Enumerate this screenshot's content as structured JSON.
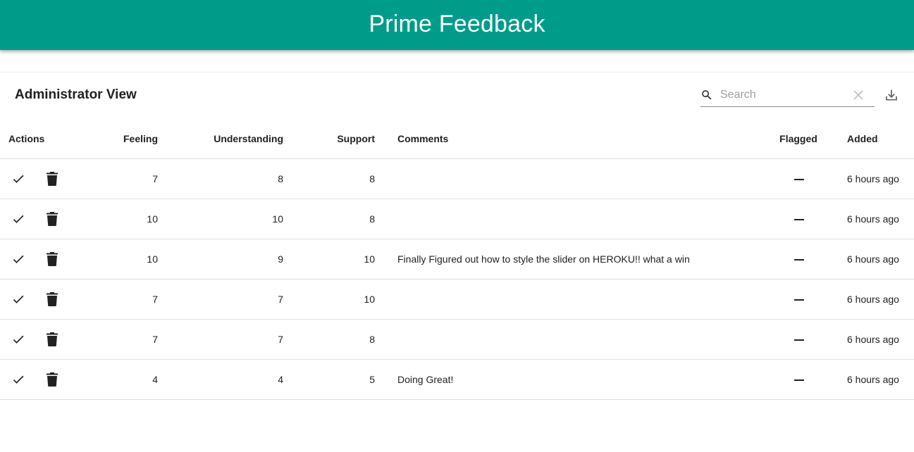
{
  "app": {
    "title": "Prime Feedback",
    "accent_color": "#009c8a"
  },
  "toolbar": {
    "title": "Administrator View",
    "search_placeholder": "Search",
    "search_value": "",
    "icons": [
      "search-icon",
      "clear-icon",
      "export-icon"
    ]
  },
  "table": {
    "headers": {
      "actions": "Actions",
      "feeling": "Feeling",
      "understanding": "Understanding",
      "support": "Support",
      "comments": "Comments",
      "flagged": "Flagged",
      "added": "Added"
    },
    "rows": [
      {
        "feeling": "7",
        "understanding": "8",
        "support": "8",
        "comments": "",
        "flagged": false,
        "added": "6 hours ago"
      },
      {
        "feeling": "10",
        "understanding": "10",
        "support": "8",
        "comments": "",
        "flagged": false,
        "added": "6 hours ago"
      },
      {
        "feeling": "10",
        "understanding": "9",
        "support": "10",
        "comments": "Finally Figured out how to style the slider on HEROKU!! what a win",
        "flagged": false,
        "added": "6 hours ago"
      },
      {
        "feeling": "7",
        "understanding": "7",
        "support": "10",
        "comments": "",
        "flagged": false,
        "added": "6 hours ago"
      },
      {
        "feeling": "7",
        "understanding": "7",
        "support": "8",
        "comments": "",
        "flagged": false,
        "added": "6 hours ago"
      },
      {
        "feeling": "4",
        "understanding": "4",
        "support": "5",
        "comments": "Doing Great!",
        "flagged": false,
        "added": "6 hours ago"
      }
    ]
  }
}
